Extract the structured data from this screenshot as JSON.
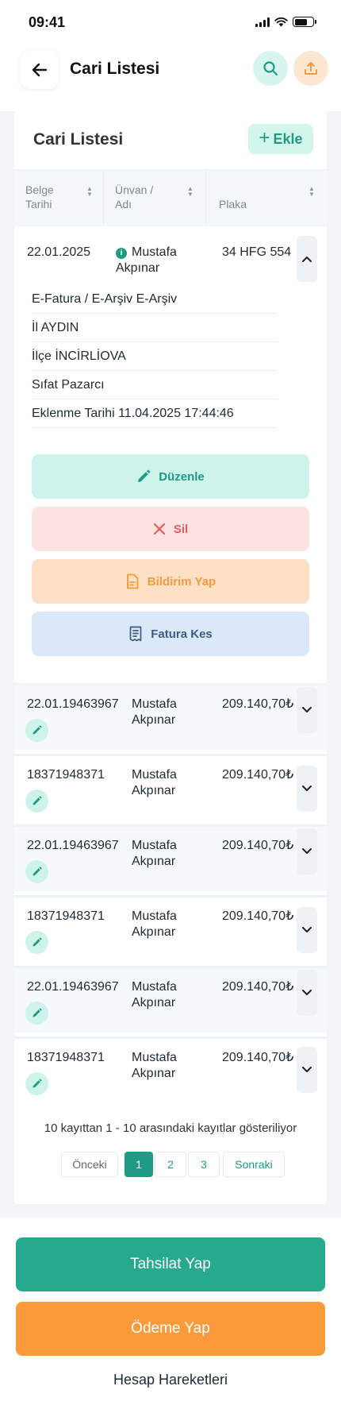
{
  "status_bar": {
    "time": "09:41"
  },
  "header": {
    "title": "Cari Listesi"
  },
  "card": {
    "title": "Cari Listesi",
    "add_label": "Ekle"
  },
  "table": {
    "columns": [
      {
        "label": "Belge Tarihi"
      },
      {
        "label": "Ünvan / Adı"
      },
      {
        "label": "Plaka"
      }
    ]
  },
  "expanded_row": {
    "date": "22.01.2025",
    "name": "Mustafa Akpınar",
    "plate": "34 HFG 554",
    "details": [
      "E-Fatura / E-Arşiv E-Arşiv",
      "İl AYDIN",
      "İlçe İNCİRLİOVA",
      "Sıfat Pazarcı",
      "Eklenme Tarihi 11.04.2025 17:44:46"
    ],
    "actions": {
      "edit": "Düzenle",
      "delete": "Sil",
      "notify": "Bildirim Yap",
      "invoice": "Fatura Kes"
    }
  },
  "rows": [
    {
      "date": "22.01.19463967",
      "name": "Mustafa Akpınar",
      "amount": "209.140,70₺"
    },
    {
      "date": "18371948371",
      "name": "Mustafa Akpınar",
      "amount": "209.140,70₺"
    },
    {
      "date": "22.01.19463967",
      "name": "Mustafa Akpınar",
      "amount": "209.140,70₺"
    },
    {
      "date": "18371948371",
      "name": "Mustafa Akpınar",
      "amount": "209.140,70₺"
    },
    {
      "date": "22.01.19463967",
      "name": "Mustafa Akpınar",
      "amount": "209.140,70₺"
    },
    {
      "date": "18371948371",
      "name": "Mustafa Akpınar",
      "amount": "209.140,70₺"
    }
  ],
  "pagination": {
    "summary": "10 kayıttan 1 - 10 arasındaki kayıtlar gösteriliyor",
    "prev": "Önceki",
    "pages": [
      "1",
      "2",
      "3"
    ],
    "current": "1",
    "next": "Sonraki"
  },
  "bottom": {
    "collect": "Tahsilat Yap",
    "pay": "Ödeme Yap",
    "movements": "Hesap Hareketleri"
  },
  "colors": {
    "primary": "#1f9a84",
    "orange": "#fb9a3b",
    "danger": "#e35d5d",
    "navy": "#3d5c85"
  }
}
